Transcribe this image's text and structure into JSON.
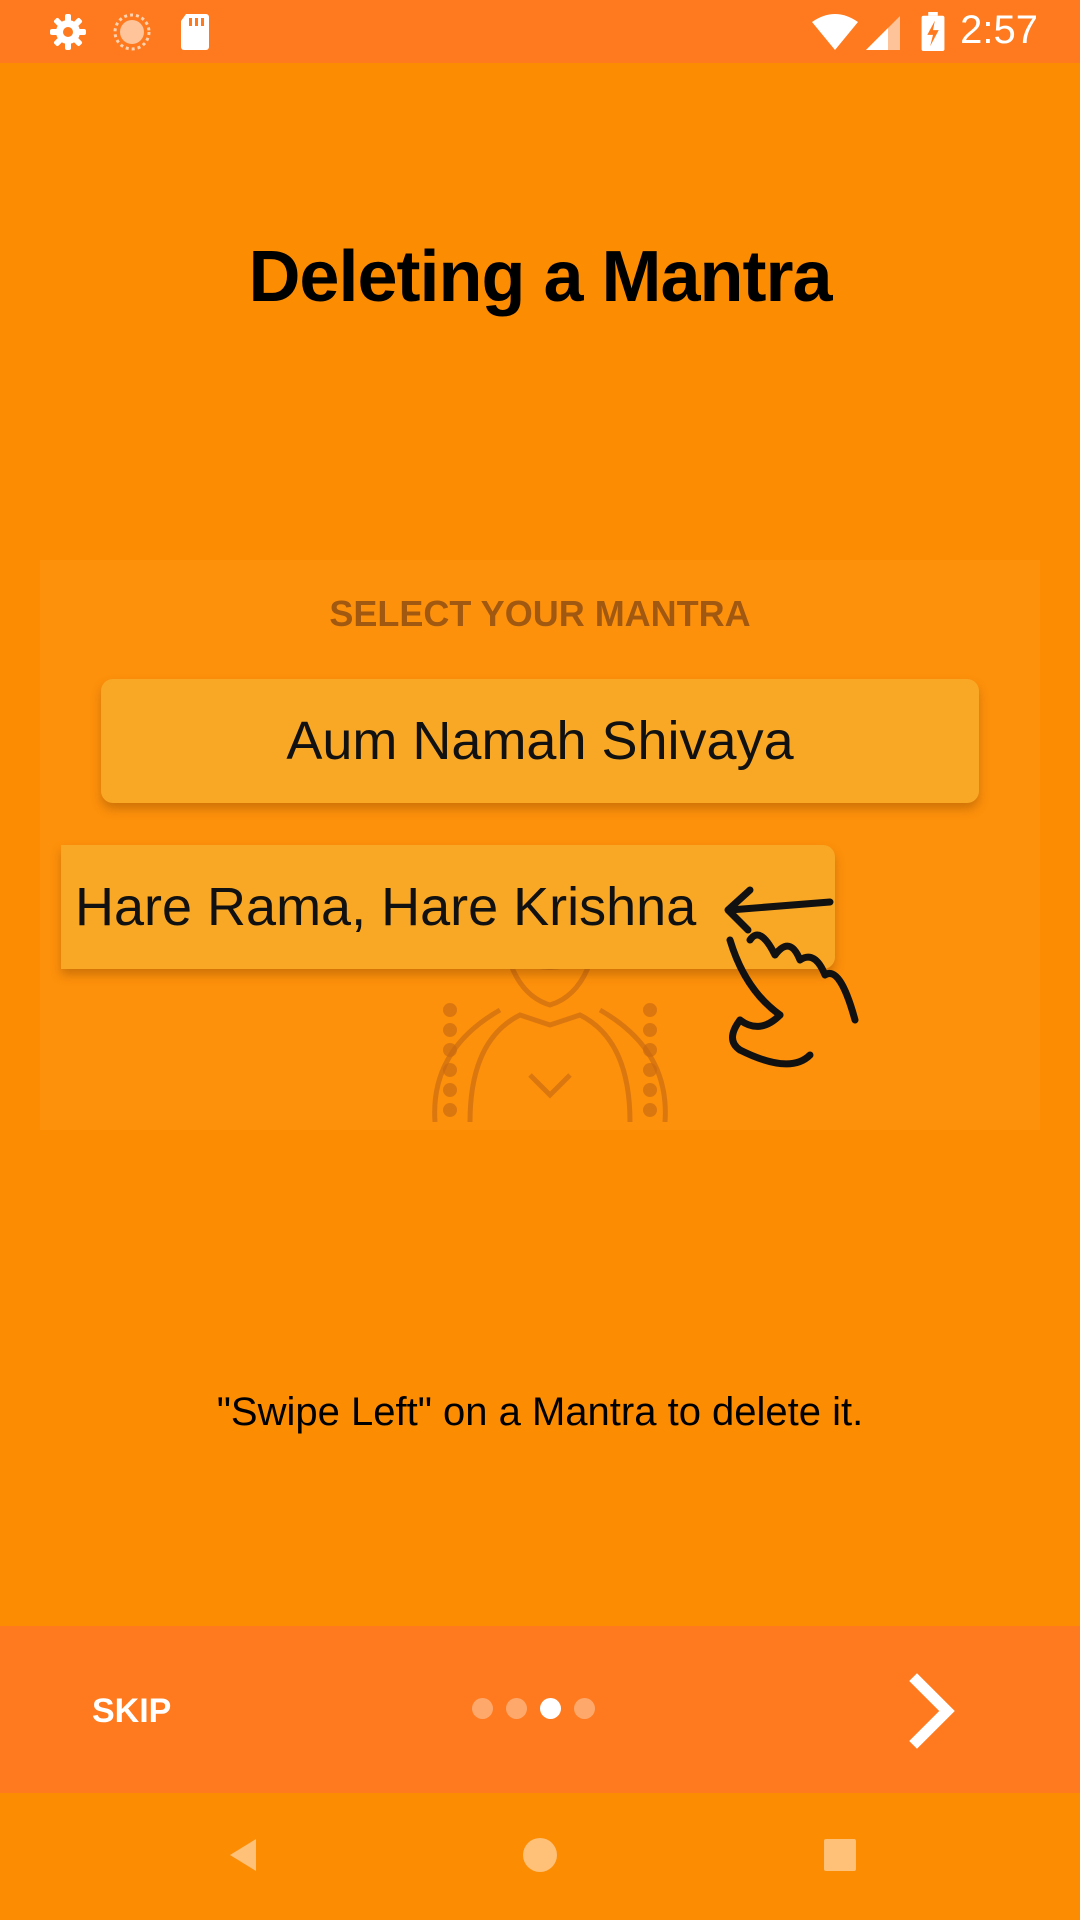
{
  "status_bar": {
    "time": "2:57",
    "left_icons": [
      "settings-icon",
      "sync-icon",
      "sd-card-icon"
    ],
    "right_icons": [
      "wifi-icon",
      "signal-icon",
      "battery-charging-icon"
    ]
  },
  "page": {
    "title": "Deleting a Mantra",
    "illustration": {
      "heading": "SELECT YOUR MANTRA",
      "mantras": [
        "Aum Namah Shivaya",
        "Hare Rama, Hare Krishna"
      ]
    },
    "instruction": "\"Swipe Left\" on a Mantra to delete it."
  },
  "bottom_bar": {
    "skip_label": "SKIP",
    "page_indicator": {
      "total": 4,
      "active_index": 2
    },
    "next_icon": "chevron-right-icon"
  },
  "nav_bar": {
    "buttons": [
      "back-icon",
      "home-icon",
      "recents-icon"
    ]
  },
  "colors": {
    "background": "#FC8C02",
    "bars": "#FF7A1E",
    "card": "#F9A826"
  }
}
